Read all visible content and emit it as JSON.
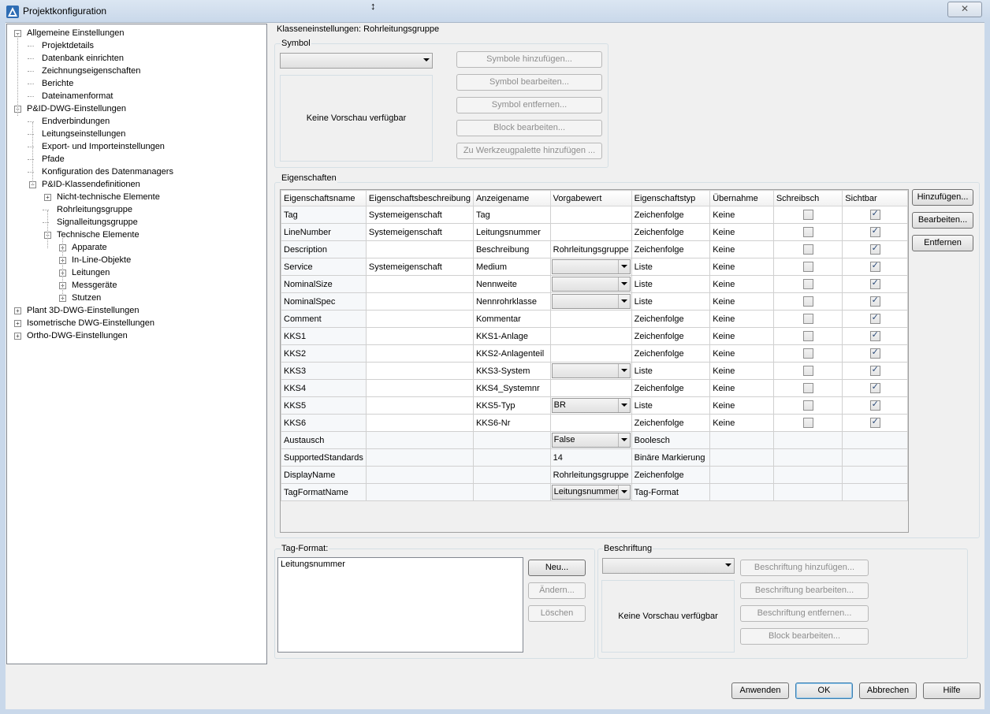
{
  "window": {
    "title": "Projektkonfiguration",
    "close": "✕"
  },
  "tree": {
    "items": [
      {
        "label": "Allgemeine Einstellungen",
        "indent": 0,
        "expander": "−"
      },
      {
        "label": "Projektdetails",
        "indent": 1,
        "expander": ""
      },
      {
        "label": "Datenbank einrichten",
        "indent": 1,
        "expander": ""
      },
      {
        "label": "Zeichnungseigenschaften",
        "indent": 1,
        "expander": ""
      },
      {
        "label": "Berichte",
        "indent": 1,
        "expander": ""
      },
      {
        "label": "Dateinamenformat",
        "indent": 1,
        "expander": ""
      },
      {
        "label": "P&ID-DWG-Einstellungen",
        "indent": 0,
        "expander": "−"
      },
      {
        "label": "Endverbindungen",
        "indent": 1,
        "expander": ""
      },
      {
        "label": "Leitungseinstellungen",
        "indent": 1,
        "expander": ""
      },
      {
        "label": "Export- und Importeinstellungen",
        "indent": 1,
        "expander": ""
      },
      {
        "label": "Pfade",
        "indent": 1,
        "expander": ""
      },
      {
        "label": "Konfiguration des Datenmanagers",
        "indent": 1,
        "expander": ""
      },
      {
        "label": "P&ID-Klassendefinitionen",
        "indent": 1,
        "expander": "−"
      },
      {
        "label": "Nicht-technische Elemente",
        "indent": 2,
        "expander": "+"
      },
      {
        "label": "Rohrleitungsgruppe",
        "indent": 2,
        "expander": ""
      },
      {
        "label": "Signalleitungsgruppe",
        "indent": 2,
        "expander": ""
      },
      {
        "label": "Technische Elemente",
        "indent": 2,
        "expander": "−"
      },
      {
        "label": "Apparate",
        "indent": 3,
        "expander": "+"
      },
      {
        "label": "In-Line-Objekte",
        "indent": 3,
        "expander": "+"
      },
      {
        "label": "Leitungen",
        "indent": 3,
        "expander": "+"
      },
      {
        "label": "Messgeräte",
        "indent": 3,
        "expander": "+"
      },
      {
        "label": "Stutzen",
        "indent": 3,
        "expander": "+"
      },
      {
        "label": "Plant 3D-DWG-Einstellungen",
        "indent": 0,
        "expander": "+"
      },
      {
        "label": "Isometrische DWG-Einstellungen",
        "indent": 0,
        "expander": "+"
      },
      {
        "label": "Ortho-DWG-Einstellungen",
        "indent": 0,
        "expander": "+"
      }
    ]
  },
  "class_settings": {
    "heading": "Klasseneinstellungen: Rohrleitungsgruppe"
  },
  "symbol": {
    "group_label": "Symbol",
    "combo_value": "",
    "preview_text": "Keine Vorschau verfügbar",
    "buttons": [
      "Symbole hinzufügen...",
      "Symbol bearbeiten...",
      "Symbol entfernen...",
      "Block bearbeiten...",
      "Zu Werkzeugpalette hinzufügen ..."
    ]
  },
  "properties": {
    "group_label": "Eigenschaften",
    "columns": [
      "Eigenschaftsname",
      "Eigenschaftsbeschreibung",
      "Anzeigename",
      "Vorgabewert",
      "Eigenschaftstyp",
      "Übernahme",
      "Schreibsch",
      "Sichtbar"
    ],
    "rows": [
      {
        "name": "Tag",
        "desc": "Systemeigenschaft",
        "display": "Tag",
        "default": "",
        "combo": false,
        "type": "Zeichenfolge",
        "inherit": "Keine",
        "readonly": false,
        "visible": true,
        "sys": false
      },
      {
        "name": "LineNumber",
        "desc": "Systemeigenschaft",
        "display": "Leitungsnummer",
        "default": "",
        "combo": false,
        "type": "Zeichenfolge",
        "inherit": "Keine",
        "readonly": false,
        "visible": true,
        "sys": false
      },
      {
        "name": "Description",
        "desc": "",
        "display": "Beschreibung",
        "default": "Rohrleitungsgruppe",
        "combo": false,
        "type": "Zeichenfolge",
        "inherit": "Keine",
        "readonly": false,
        "visible": true,
        "sys": false
      },
      {
        "name": "Service",
        "desc": "Systemeigenschaft",
        "display": "Medium",
        "default": "",
        "combo": true,
        "type": "Liste",
        "inherit": "Keine",
        "readonly": false,
        "visible": true,
        "sys": false
      },
      {
        "name": "NominalSize",
        "desc": "",
        "display": "Nennweite",
        "default": "",
        "combo": true,
        "type": "Liste",
        "inherit": "Keine",
        "readonly": false,
        "visible": true,
        "sys": false
      },
      {
        "name": "NominalSpec",
        "desc": "",
        "display": "Nennrohrklasse",
        "default": "",
        "combo": true,
        "type": "Liste",
        "inherit": "Keine",
        "readonly": false,
        "visible": true,
        "sys": false
      },
      {
        "name": "Comment",
        "desc": "",
        "display": "Kommentar",
        "default": "",
        "combo": false,
        "type": "Zeichenfolge",
        "inherit": "Keine",
        "readonly": false,
        "visible": true,
        "sys": false
      },
      {
        "name": "KKS1",
        "desc": "",
        "display": "KKS1-Anlage",
        "default": "",
        "combo": false,
        "type": "Zeichenfolge",
        "inherit": "Keine",
        "readonly": false,
        "visible": true,
        "sys": false
      },
      {
        "name": "KKS2",
        "desc": "",
        "display": "KKS2-Anlagenteil",
        "default": "",
        "combo": false,
        "type": "Zeichenfolge",
        "inherit": "Keine",
        "readonly": false,
        "visible": true,
        "sys": false
      },
      {
        "name": "KKS3",
        "desc": "",
        "display": "KKS3-System",
        "default": "",
        "combo": true,
        "type": "Liste",
        "inherit": "Keine",
        "readonly": false,
        "visible": true,
        "sys": false
      },
      {
        "name": "KKS4",
        "desc": "",
        "display": "KKS4_Systemnr",
        "default": "",
        "combo": false,
        "type": "Zeichenfolge",
        "inherit": "Keine",
        "readonly": false,
        "visible": true,
        "sys": false
      },
      {
        "name": "KKS5",
        "desc": "",
        "display": "KKS5-Typ",
        "default": "BR",
        "combo": true,
        "type": "Liste",
        "inherit": "Keine",
        "readonly": false,
        "visible": true,
        "sys": false
      },
      {
        "name": "KKS6",
        "desc": "",
        "display": "KKS6-Nr",
        "default": "",
        "combo": false,
        "type": "Zeichenfolge",
        "inherit": "Keine",
        "readonly": false,
        "visible": true,
        "sys": false
      },
      {
        "name": "Austausch",
        "desc": "",
        "display": "",
        "default": "False",
        "combo": true,
        "type": "Boolesch",
        "inherit": "",
        "readonly": null,
        "visible": null,
        "sys": true
      },
      {
        "name": "SupportedStandards",
        "desc": "",
        "display": "",
        "default": "14",
        "combo": false,
        "type": "Binäre Markierung",
        "inherit": "",
        "readonly": null,
        "visible": null,
        "sys": true
      },
      {
        "name": "DisplayName",
        "desc": "",
        "display": "",
        "default": "Rohrleitungsgruppe",
        "combo": false,
        "type": "Zeichenfolge",
        "inherit": "",
        "readonly": null,
        "visible": null,
        "sys": true
      },
      {
        "name": "TagFormatName",
        "desc": "",
        "display": "",
        "default": "Leitungsnummer",
        "combo": true,
        "type": "Tag-Format",
        "inherit": "",
        "readonly": null,
        "visible": null,
        "sys": true
      }
    ],
    "side_buttons": {
      "add": "Hinzufügen...",
      "edit": "Bearbeiten...",
      "remove": "Entfernen"
    }
  },
  "tag_format": {
    "group_label": "Tag-Format:",
    "items": [
      "Leitungsnummer"
    ],
    "buttons": {
      "new": "Neu...",
      "change": "Ändern...",
      "delete": "Löschen"
    }
  },
  "labeling": {
    "group_label": "Beschriftung",
    "combo_value": "",
    "preview_text": "Keine Vorschau verfügbar",
    "buttons": [
      "Beschriftung hinzufügen...",
      "Beschriftung bearbeiten...",
      "Beschriftung entfernen...",
      "Block bearbeiten..."
    ]
  },
  "footer": {
    "apply": "Anwenden",
    "ok": "OK",
    "cancel": "Abbrechen",
    "help": "Hilfe"
  }
}
